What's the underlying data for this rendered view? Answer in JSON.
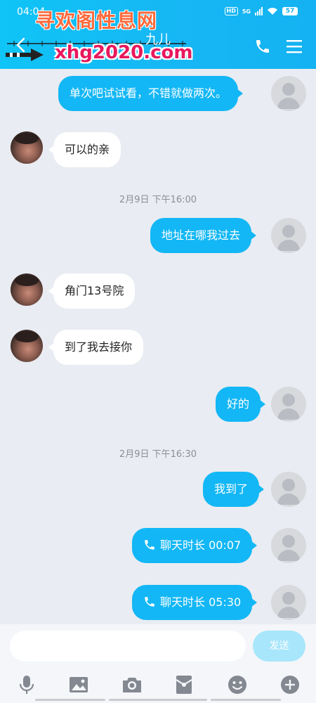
{
  "status_bar": {
    "time": "04:04",
    "network": "5G",
    "battery": "57"
  },
  "watermark": {
    "site_name": "寻欢阁性息网",
    "url": "xhg2020.com"
  },
  "header": {
    "contact_name": "九儿",
    "contact_sub": "iFi"
  },
  "messages": [
    {
      "dir": "out",
      "text": "单次吧试试看，不错就做两次。"
    },
    {
      "dir": "in",
      "text": "可以的亲"
    },
    {
      "time": "2月9日 下午16:00"
    },
    {
      "dir": "out",
      "text": "地址在哪我过去"
    },
    {
      "dir": "in",
      "text": "角门13号院"
    },
    {
      "dir": "in",
      "text": "到了我去接你"
    },
    {
      "dir": "out",
      "text": "好的"
    },
    {
      "time": "2月9日 下午16:30"
    },
    {
      "dir": "out",
      "text": "我到了"
    },
    {
      "dir": "out",
      "call": true,
      "text": "聊天时长 00:07"
    },
    {
      "dir": "out",
      "call": true,
      "text": "聊天时长 05:30"
    }
  ],
  "input": {
    "placeholder": "",
    "send_label": "发送"
  },
  "toolbar": [
    "mic-icon",
    "image-icon",
    "camera-icon",
    "red-packet-icon",
    "emoji-icon",
    "plus-icon"
  ],
  "colors": {
    "header": "#14b2f2",
    "bubble_out": "#13b7f5",
    "bubble_in": "#ffffff",
    "background": "#e9ecf2"
  }
}
